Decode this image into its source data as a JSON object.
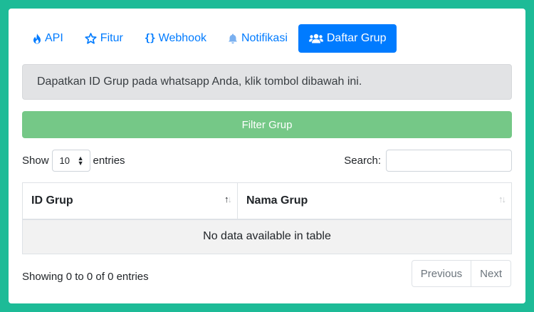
{
  "tabs": [
    {
      "label": "API",
      "icon": "fire-icon",
      "active": false
    },
    {
      "label": "Fitur",
      "icon": "star-icon",
      "active": false
    },
    {
      "label": "Webhook",
      "icon": "code-braces-icon",
      "active": false
    },
    {
      "label": "Notifikasi",
      "icon": "bell-icon",
      "active": false
    },
    {
      "label": "Daftar Grup",
      "icon": "users-icon",
      "active": true
    }
  ],
  "alert": {
    "text": "Dapatkan ID Grup pada whatsapp Anda, klik tombol dibawah ini."
  },
  "filter_button": {
    "label": "Filter Grup"
  },
  "length": {
    "prefix": "Show",
    "value": "10",
    "suffix": "entries"
  },
  "search": {
    "label": "Search:",
    "value": ""
  },
  "table": {
    "columns": [
      "ID Grup",
      "Nama Grup"
    ],
    "empty_message": "No data available in table"
  },
  "info": "Showing 0 to 0 of 0 entries",
  "pagination": {
    "previous": "Previous",
    "next": "Next"
  },
  "colors": {
    "background": "#1dbb97",
    "primary": "#007bff",
    "success_disabled": "#75c887",
    "alert_bg": "#e2e3e5"
  }
}
